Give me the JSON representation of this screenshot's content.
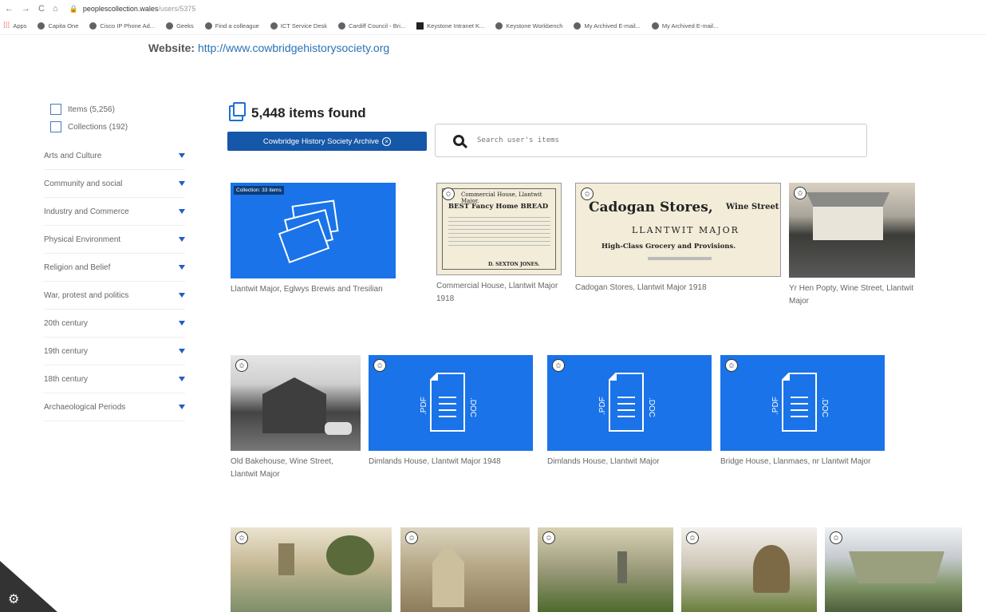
{
  "browser": {
    "nav": [
      "←",
      "→",
      "C",
      "⌂"
    ],
    "url_host": "peoplescollection.wales",
    "url_path": "/users/5375",
    "bookmarks": [
      "Apps",
      "Capita One",
      "Cisco IP Phone Ad...",
      "Geeks",
      "Find a colleague",
      "ICT Service Desk",
      "Cardiff Council - Bri...",
      "Keystone Intranet K...",
      "Keystone Workbench",
      "My Archived E-mail...",
      "My Archived E-mail..."
    ]
  },
  "website": {
    "label": "Website:",
    "url": "http://www.cowbridgehistorysociety.org"
  },
  "sidebar": {
    "checkboxes": [
      "Items (5,256)",
      "Collections (192)"
    ],
    "facets": [
      "Arts and Culture",
      "Community and social",
      "Industry and Commerce",
      "Physical Environment",
      "Religion and Belief",
      "War, protest and politics",
      "20th century",
      "19th century",
      "18th century",
      "Archaeological Periods"
    ]
  },
  "results": {
    "count": "5,448 items found",
    "filter": "Cowbridge History Society Archive",
    "filter_remove": "×",
    "search_placeholder": "Search user's items"
  },
  "cards": [
    {
      "caption": "Llantwit Major, Eglwys Brewis and Tresilian",
      "badge": "Collection: 33 items"
    },
    {
      "caption": "Commercial House, Llantwit Major 1918"
    },
    {
      "caption": "Cadogan Stores, Llantwit Major 1918"
    },
    {
      "caption": "Yr Hen Popty, Wine Street, Llantwit Major"
    },
    {
      "caption": "Old Bakehouse, Wine Street, Llantwit Major"
    },
    {
      "caption": "Dimlands House, Llantwit Major 1948"
    },
    {
      "caption": "Dimlands House, Llantwit Major"
    },
    {
      "caption": "Bridge House, Llanmaes, nr Llantwit Major"
    }
  ],
  "doc_labels": {
    "left": ".PDF",
    "right": ".DOC"
  },
  "news1": {
    "l1": "Commercial House, Llantwit Major.",
    "l2": "BEST Fancy Home BREAD",
    "l3": "D. SEXTON JONES."
  },
  "news2": {
    "l1": "Cadogan Stores,",
    "l1b": "Wine Street",
    "l2": "LLANTWIT MAJOR",
    "l3": "High-Class Grocery and Provisions."
  },
  "colors": {
    "accent": "#1a73e8",
    "chip": "#1557a8",
    "link": "#2a72b5"
  }
}
